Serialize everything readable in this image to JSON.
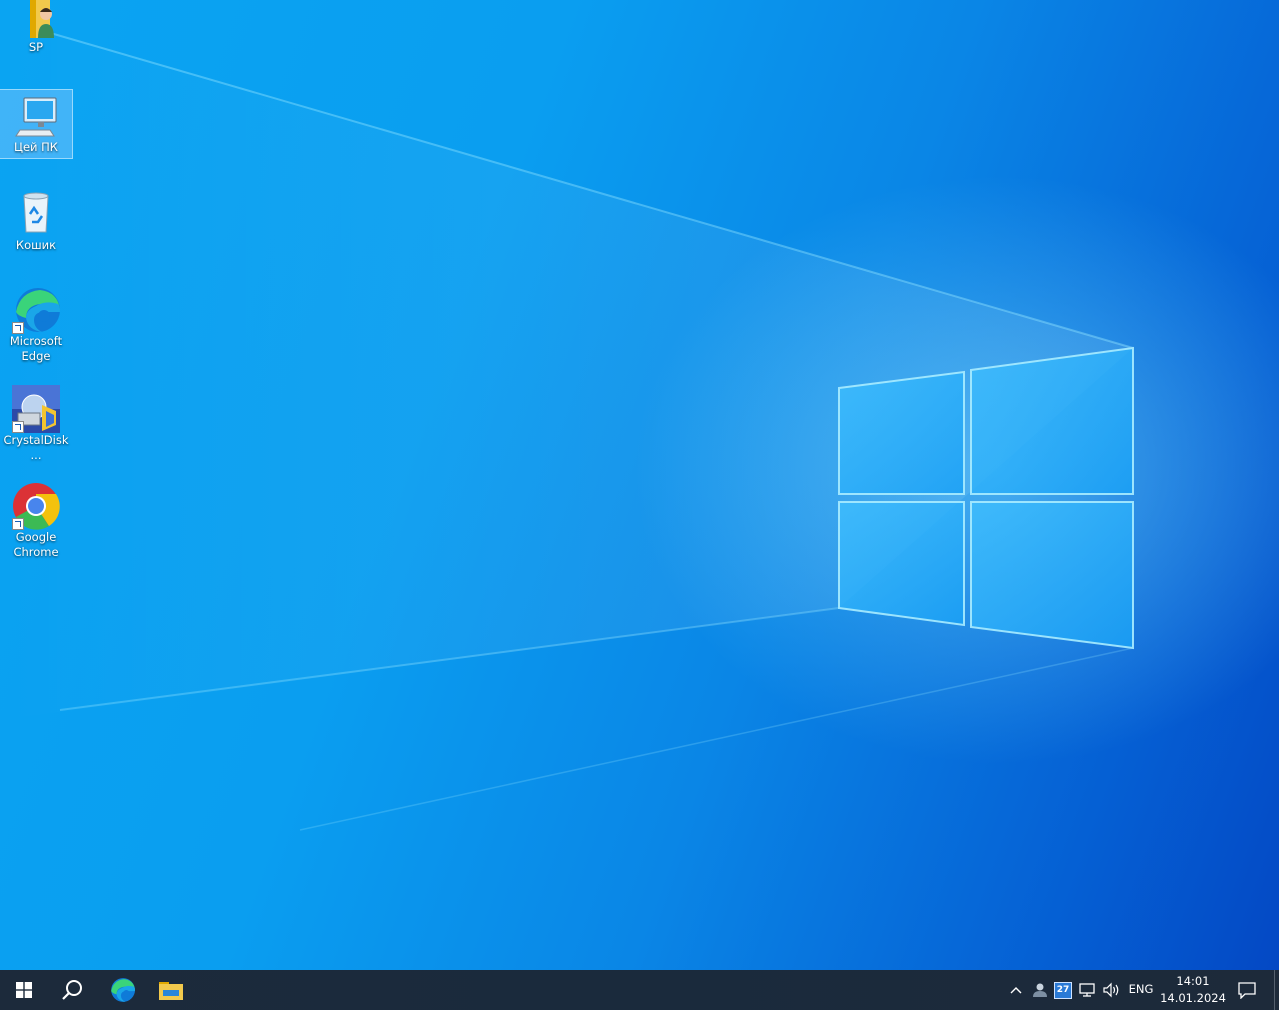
{
  "desktop": {
    "icons": [
      {
        "label": "SP",
        "icon": "user-folder-icon"
      },
      {
        "label": "Цей ПК",
        "icon": "this-pc-icon",
        "selected": true
      },
      {
        "label": "Кошик",
        "icon": "recycle-bin-icon"
      },
      {
        "label": "Microsoft Edge",
        "icon": "edge-icon",
        "shortcut": true
      },
      {
        "label": "CrystalDisk...",
        "icon": "crystaldisk-icon",
        "shortcut": true
      },
      {
        "label": "Google Chrome",
        "icon": "chrome-icon",
        "shortcut": true
      }
    ]
  },
  "taskbar": {
    "pinned": [
      "start-icon",
      "search-icon",
      "edge-icon",
      "file-explorer-icon"
    ],
    "tray": {
      "calendar_badge": "27",
      "language": "ENG",
      "time": "14:01",
      "date": "14.01.2024"
    }
  },
  "colors": {
    "taskbar": "#1c2a3b",
    "desktop_light": "#0aa4f2",
    "desktop_dark": "#0448c4"
  }
}
